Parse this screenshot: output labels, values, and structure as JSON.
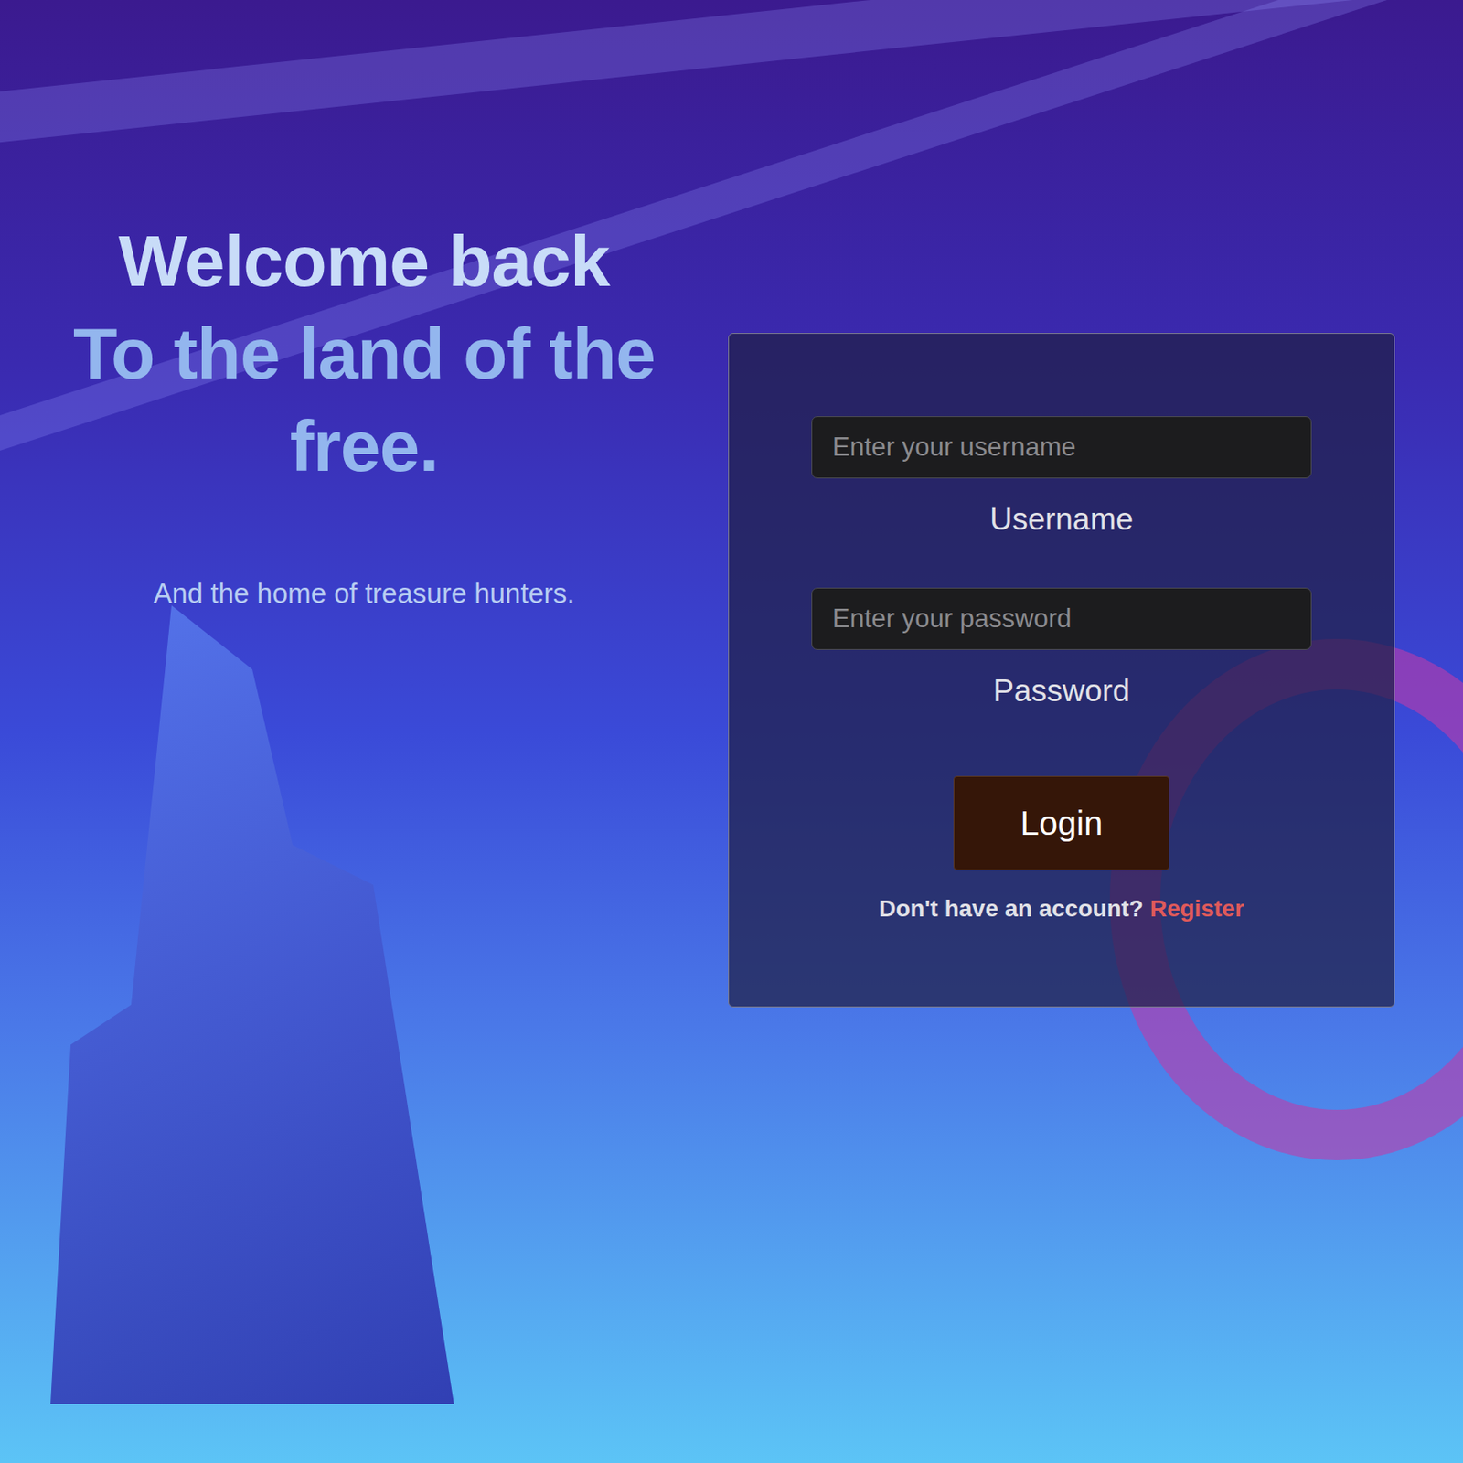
{
  "hero": {
    "title": "Welcome back",
    "subtitle_lines": "To the land of the free.",
    "tagline": "And the home of treasure hunters."
  },
  "form": {
    "fields": [
      {
        "placeholder": "Enter your username",
        "label": "Username",
        "type": "text"
      },
      {
        "placeholder": "Enter your password",
        "label": "Password",
        "type": "password"
      }
    ],
    "submit": "Login",
    "prompt": "Don't have an account?",
    "link": "Register"
  }
}
